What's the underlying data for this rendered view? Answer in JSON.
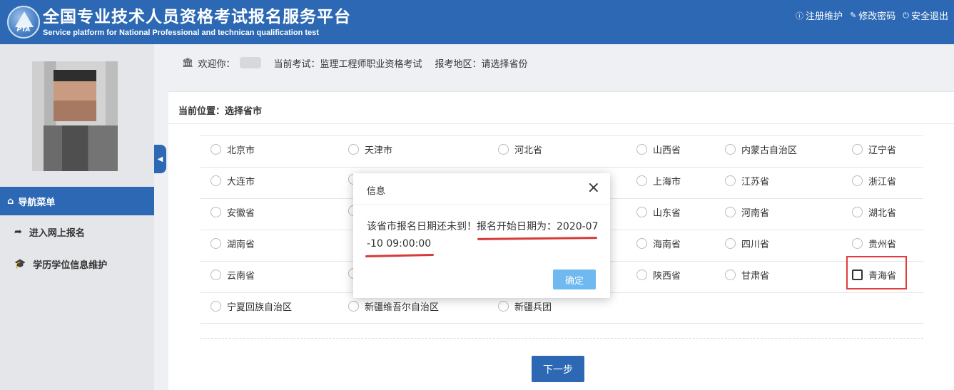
{
  "header": {
    "title_cn": "全国专业技术人员资格考试报名服务平台",
    "title_en": "Service platform for National Professional and technican qualification test",
    "logo_text": "PTA",
    "links": [
      {
        "icon": "info-icon",
        "label": "注册维护"
      },
      {
        "icon": "edit-icon",
        "label": "修改密码"
      },
      {
        "icon": "power-icon",
        "label": "安全退出"
      }
    ]
  },
  "sidebar": {
    "nav_title": "导航菜单",
    "items": [
      {
        "icon": "share-arrow-icon",
        "label": "进入网上报名"
      },
      {
        "icon": "graduation-cap-icon",
        "label": "学历学位信息维护"
      }
    ]
  },
  "welcome": {
    "greeting": "欢迎你：",
    "exam_label": "当前考试：监理工程师职业资格考试",
    "region_label": "报考地区：请选择省份"
  },
  "panel": {
    "location": "当前位置：选择省市",
    "rows": [
      [
        "北京市",
        "天津市",
        "河北省",
        "山西省",
        "内蒙古自治区",
        "辽宁省"
      ],
      [
        "大连市",
        "",
        "",
        "上海市",
        "江苏省",
        "浙江省"
      ],
      [
        "安徽省",
        "",
        "",
        "山东省",
        "河南省",
        "湖北省"
      ],
      [
        "湖南省",
        "",
        "",
        "海南省",
        "四川省",
        "贵州省"
      ],
      [
        "云南省",
        "",
        "",
        "陕西省",
        "甘肃省",
        "青海省"
      ],
      [
        "宁夏回族自治区",
        "新疆维吾尔自治区",
        "新疆兵团",
        "",
        "",
        ""
      ]
    ],
    "next_label": "下一步"
  },
  "modal": {
    "title": "信息",
    "close": "×",
    "message": "该省市报名日期还未到！报名开始日期为：2020-07-10 09:00:00",
    "ok_label": "确定"
  },
  "colors": {
    "brand": "#2c68b4",
    "highlight": "#e23c3c",
    "ok_button": "#6fb8f0"
  }
}
